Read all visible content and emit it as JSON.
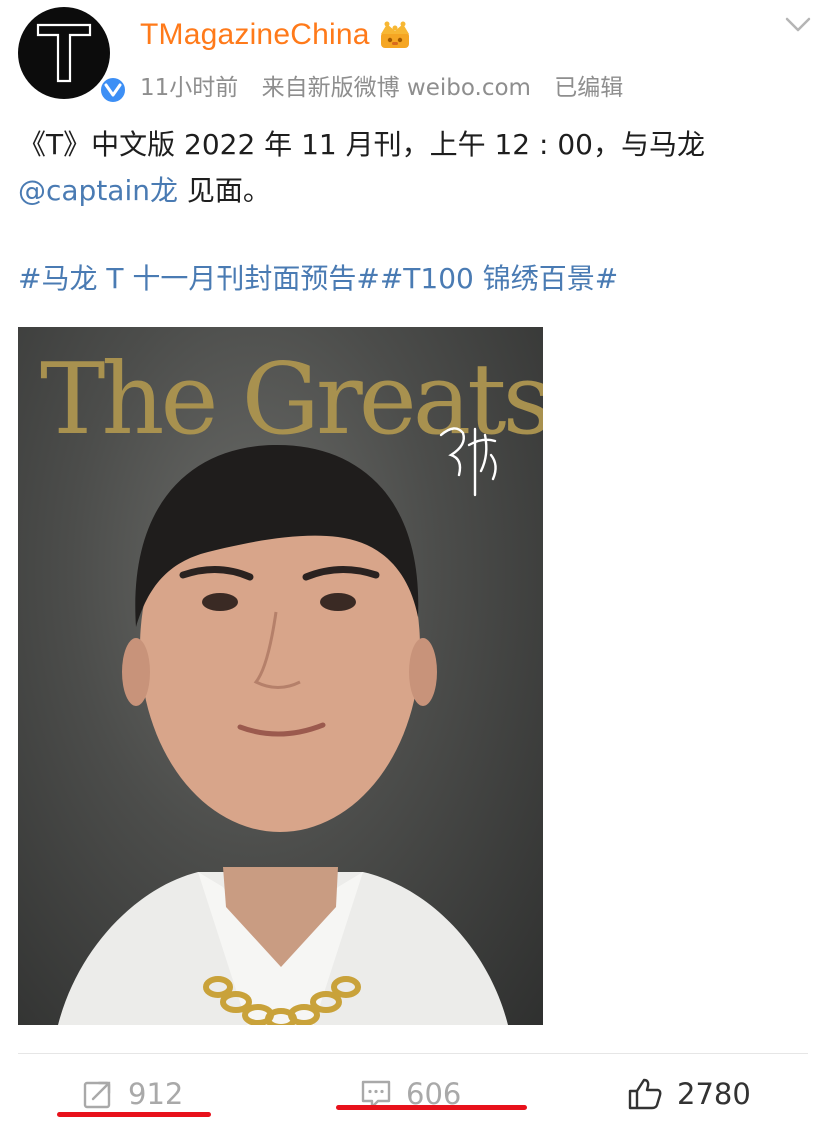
{
  "post": {
    "author": {
      "name": "TMagazineChina",
      "avatar_letter": "T",
      "badge_icon": "crown-badge-icon",
      "verified_icon": "verified-v-icon"
    },
    "meta": {
      "time": "11小时前",
      "source": "来自新版微博 weibo.com",
      "edited": "已编辑"
    },
    "text": {
      "line1": "《T》中文版 2022 年 11 月刊，上午 12 : 00，与马龙",
      "mention": "@captain龙",
      "line2_rest": " 见面。"
    },
    "hashtags": "#马龙 T 十一月刊封面预告##T100 锦绣百景#",
    "image": {
      "cover_title": "The Greats",
      "signature_icon": "autograph-icon"
    },
    "actions": {
      "repost_count": "912",
      "comment_count": "606",
      "like_count": "2780"
    }
  },
  "colors": {
    "username": "#ff7a1a",
    "link": "#4a7bb3",
    "meta": "#8e8e8e",
    "highlight_underline": "#e8111b",
    "cover_title": "#a8914f"
  }
}
